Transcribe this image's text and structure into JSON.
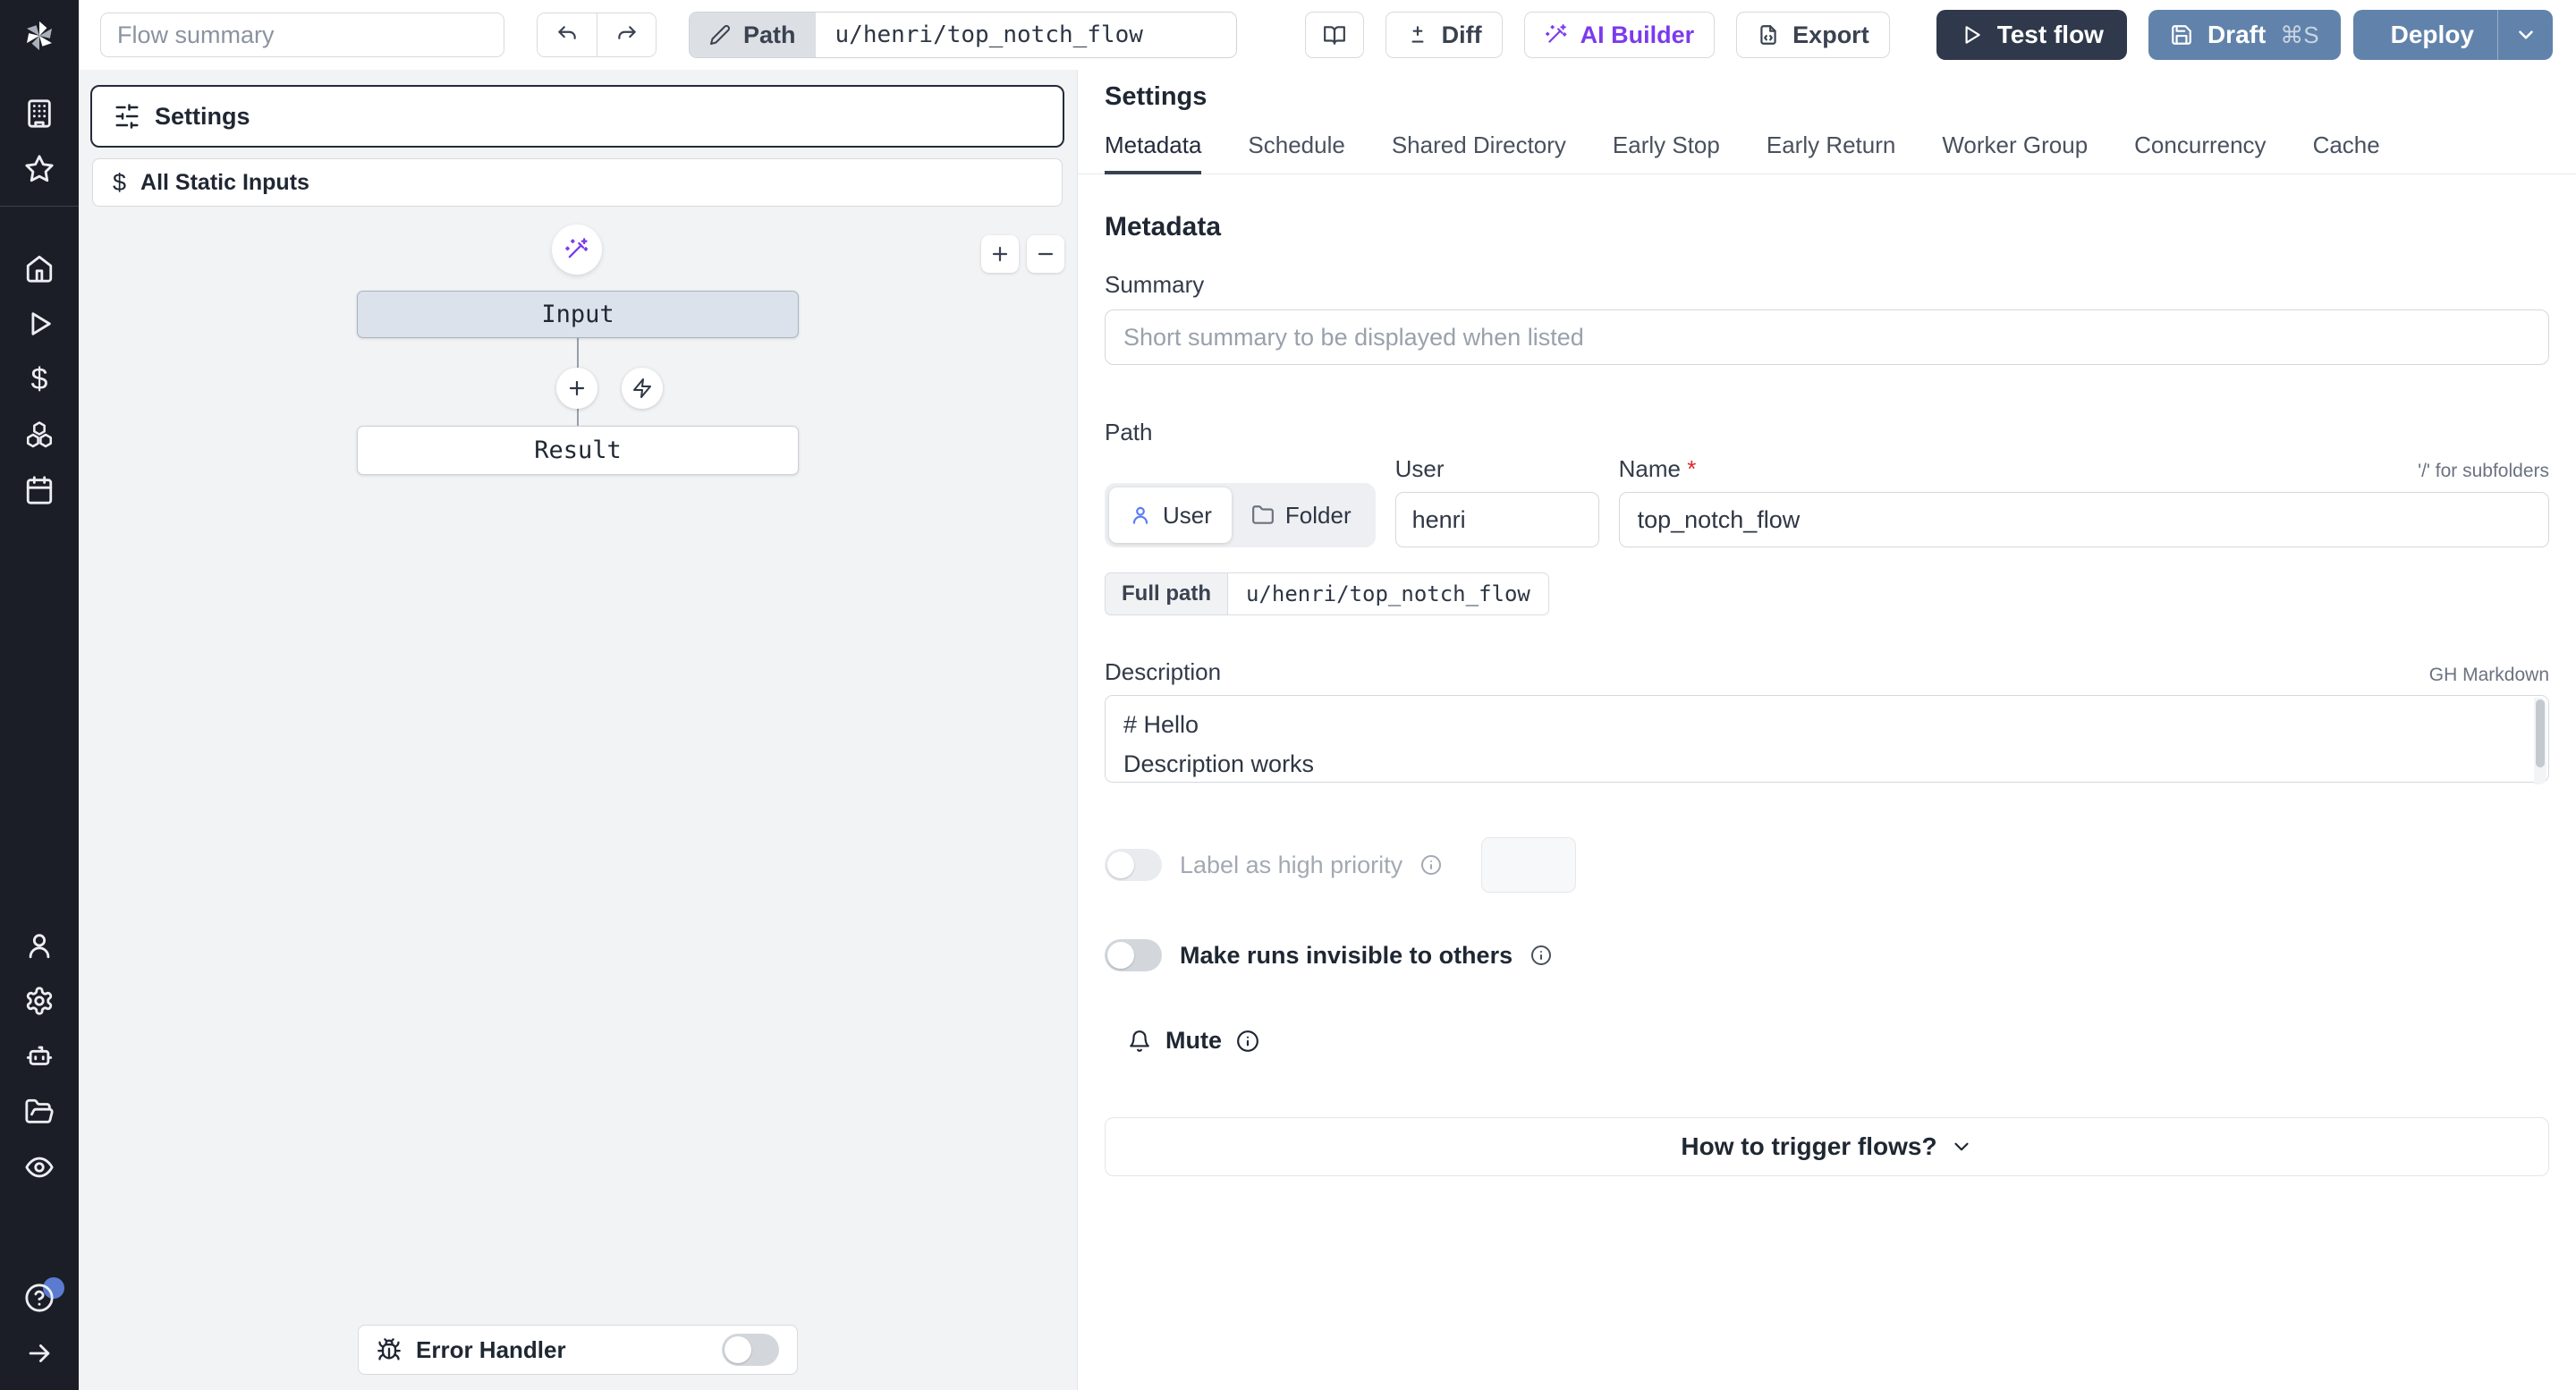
{
  "topbar": {
    "flow_summary_placeholder": "Flow summary",
    "path_label": "Path",
    "path_value": "u/henri/top_notch_flow",
    "diff_label": "Diff",
    "ai_builder_label": "AI Builder",
    "export_label": "Export",
    "test_flow_label": "Test flow",
    "draft_label": "Draft",
    "draft_shortcut": "⌘S",
    "deploy_label": "Deploy"
  },
  "sidebar": {
    "icons": [
      "windmill-logo",
      "workspace",
      "favorites",
      "home",
      "runs",
      "variables",
      "resources",
      "schedules",
      "user",
      "settings",
      "ai",
      "folders",
      "audit",
      "help",
      "expand"
    ]
  },
  "flow_panel": {
    "settings_node_label": "Settings",
    "static_inputs_label": "All Static Inputs",
    "static_inputs_glyph": "$",
    "input_node_label": "Input",
    "result_node_label": "Result",
    "error_handler_label": "Error Handler"
  },
  "settings_panel": {
    "title": "Settings",
    "tabs": [
      "Metadata",
      "Schedule",
      "Shared Directory",
      "Early Stop",
      "Early Return",
      "Worker Group",
      "Concurrency",
      "Cache"
    ],
    "active_tab": "Metadata",
    "metadata": {
      "heading": "Metadata",
      "summary_label": "Summary",
      "summary_placeholder": "Short summary to be displayed when listed",
      "path_label": "Path",
      "owner_kind_user": "User",
      "owner_kind_folder": "Folder",
      "user_label": "User",
      "user_value": "henri",
      "name_label": "Name",
      "required_mark": "*",
      "subfolders_hint": "'/' for subfolders",
      "name_value": "top_notch_flow",
      "full_path_label": "Full path",
      "full_path_value": "u/henri/top_notch_flow",
      "description_label": "Description",
      "markdown_hint": "GH Markdown",
      "description_value": "# Hello\nDescription works",
      "high_priority_label": "Label as high priority",
      "invisible_runs_label": "Make runs invisible to others",
      "mute_label": "Mute",
      "trigger_label": "How to trigger flows?"
    }
  },
  "colors": {
    "sidebar_bg": "#1b1e27",
    "accent_slate": "#6183ab",
    "dark_button": "#2f394b",
    "ai_purple": "#7c3aed",
    "link_blue": "#5b7cf7",
    "canvas_bg": "#f2f3f5",
    "input_node_fill": "#dbe2eb"
  }
}
